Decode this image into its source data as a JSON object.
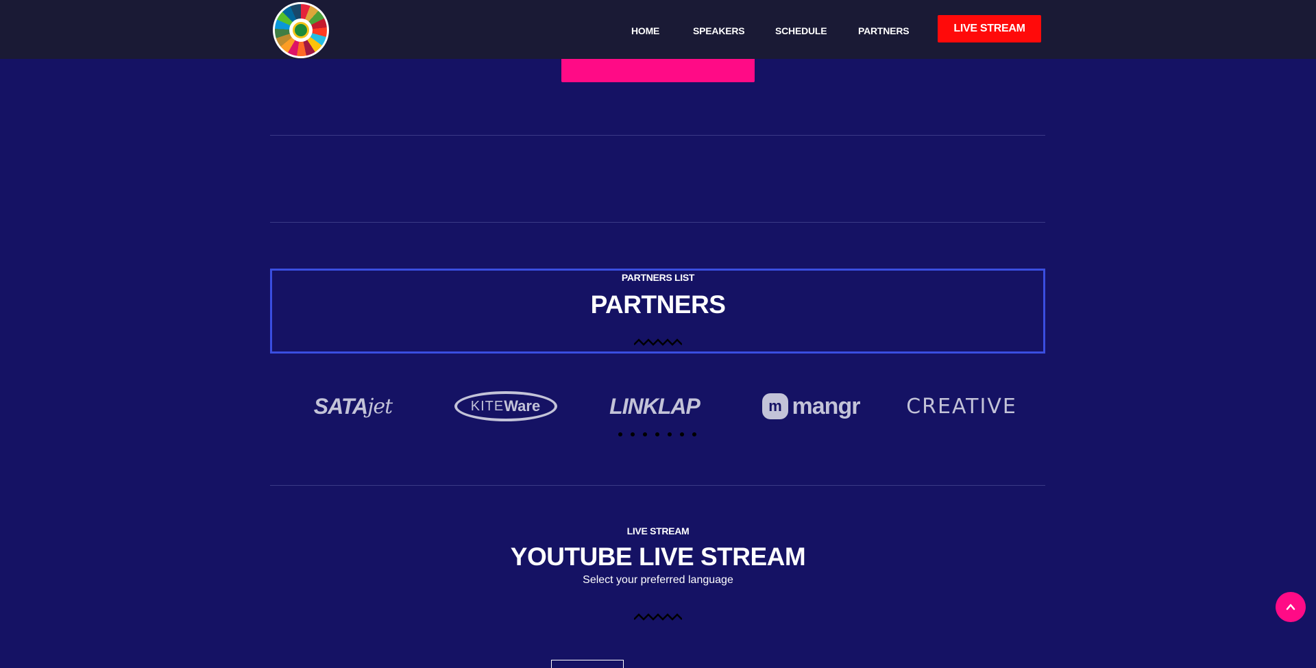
{
  "nav": {
    "home": "HOME",
    "speakers": "SPEAKERS",
    "schedule": "SCHEDULE",
    "partners": "PARTNERS",
    "live_stream": "LIVE STREAM"
  },
  "partners_section": {
    "eyebrow": "PARTNERS LIST",
    "title": "PARTNERS",
    "logos": [
      {
        "name": "SATA jet",
        "part1": "SATA",
        "part2": "jet"
      },
      {
        "name": "KITE Ware",
        "part1": "KITE",
        "part2": "Ware"
      },
      {
        "name": "LINKLAP",
        "part1": "LINKLAP"
      },
      {
        "name": "mangr",
        "part1": "mangr",
        "badge": "m"
      },
      {
        "name": "CREATIVE",
        "part1": "CREATIVE"
      }
    ],
    "carousel_pages": 7
  },
  "live_section": {
    "eyebrow": "LIVE STREAM",
    "title": "YOUTUBE LIVE STREAM",
    "subtitle": "Select your preferred language"
  },
  "colors": {
    "page_background": "#151264",
    "header_background": "#1a1a35",
    "live_button": "#ff0a0a",
    "accent_pink": "#ff0b86",
    "highlight_border": "#3a4ee0",
    "logo_gray": "#c3c3d8"
  },
  "icons": {
    "site_logo": "sdg-wheel-icon",
    "scroll_top": "chevron-up-icon",
    "divider_ornament": "zigzag-icon"
  }
}
